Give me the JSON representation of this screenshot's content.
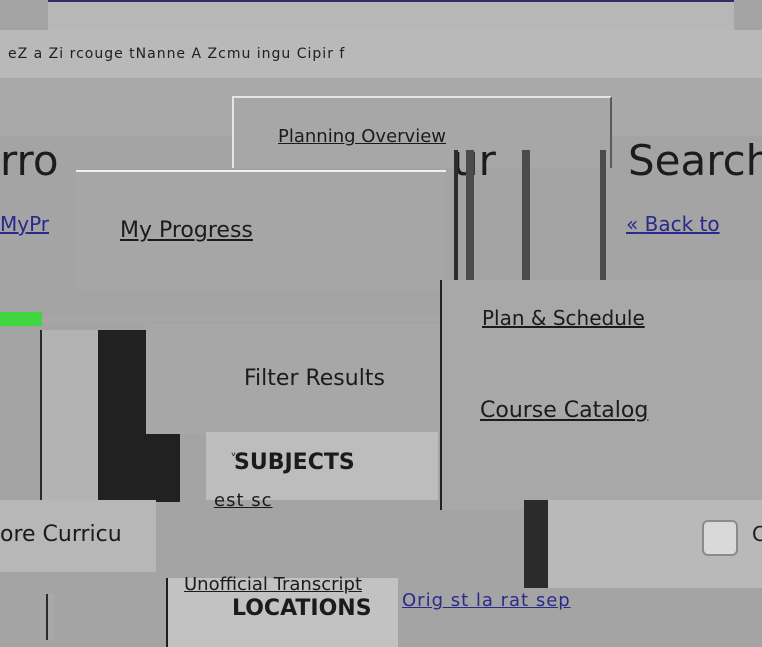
{
  "nav": {
    "planning_overview": "Planning Overview",
    "my_progress": "My Progress",
    "my_progress_left": "MyPr",
    "back_to": "Back to",
    "plan_schedule": "Plan & Schedule",
    "course_catalog": "Course Catalog",
    "unofficial_transcript": "Unofficial Transcript"
  },
  "headings": {
    "left_fragment": "rro",
    "middle_fragment": "ur",
    "right_fragment": "Search"
  },
  "filters": {
    "title": "Filter Results",
    "subjects": "SUBJECTS",
    "locations": "LOCATIONS",
    "core_curriculum": "ore Curricu",
    "checkbox_label_fragment": "C",
    "fragment_line": "est sc",
    "bottom_fragment": "Orig  st  la  rat  sep"
  },
  "top": {
    "breadcrumb": "eZ  a Zi rcouge tNanne  A  Zcmu ingu  Cipir f"
  },
  "colors": {
    "accent": "#3fd63f",
    "dark": "#212121",
    "bg": "#a4a4a4"
  },
  "icons": {
    "back": "chevron-left-double-icon",
    "chev": "chevron-down-icon",
    "checkbox": "checkbox-icon"
  }
}
